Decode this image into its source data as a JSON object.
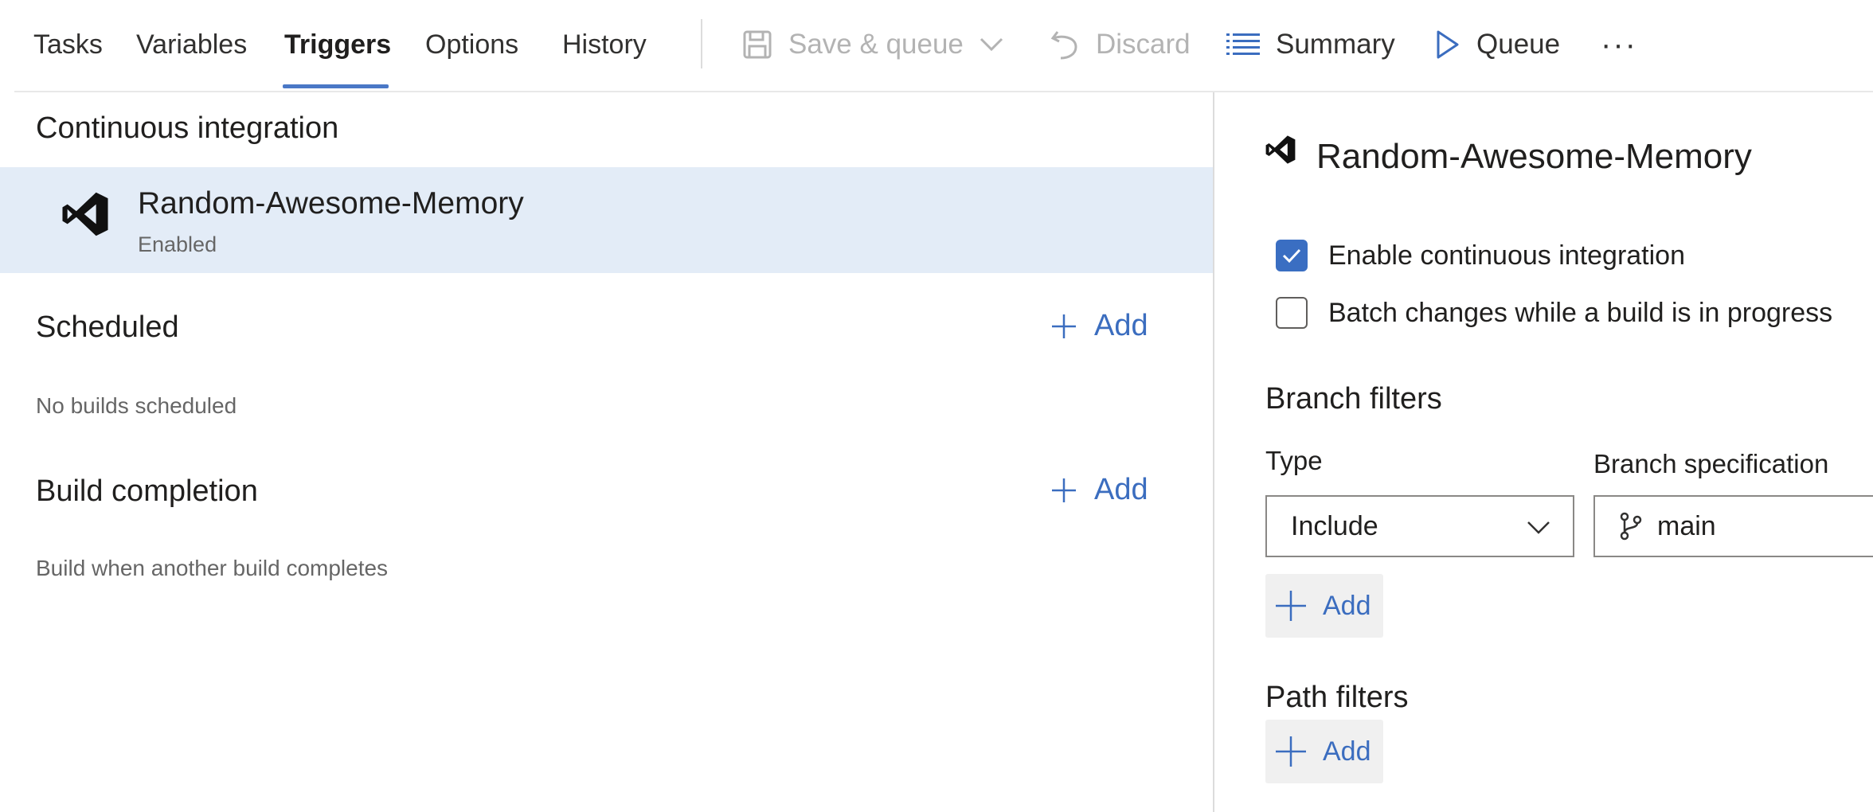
{
  "tabs": [
    {
      "label": "Tasks"
    },
    {
      "label": "Variables"
    },
    {
      "label": "Triggers",
      "active": true
    },
    {
      "label": "Options"
    },
    {
      "label": "History"
    }
  ],
  "toolbar": {
    "save_queue": "Save & queue",
    "discard": "Discard",
    "summary": "Summary",
    "queue": "Queue",
    "more": "···"
  },
  "left": {
    "ci": {
      "title": "Continuous integration",
      "repo_name": "Random-Awesome-Memory",
      "status": "Enabled"
    },
    "scheduled": {
      "title": "Scheduled",
      "add": "Add",
      "empty": "No builds scheduled"
    },
    "build_completion": {
      "title": "Build completion",
      "add": "Add",
      "description": "Build when another build completes"
    }
  },
  "right": {
    "title": "Random-Awesome-Memory",
    "enable_ci": {
      "label": "Enable continuous integration",
      "checked": true
    },
    "batch_changes": {
      "label": "Batch changes while a build is in progress",
      "checked": false
    },
    "branch_filters": {
      "title": "Branch filters",
      "type_label": "Type",
      "spec_label": "Branch specification",
      "type_value": "Include",
      "spec_value": "main",
      "add": "Add"
    },
    "path_filters": {
      "title": "Path filters",
      "add": "Add"
    }
  },
  "colors": {
    "accent": "#3b6dbf",
    "selected_row": "#e3ecf7",
    "checkbox_checked": "#3a6ec2",
    "tab_underline": "#4a78c6"
  },
  "icons": {
    "logo": "visual-studio-icon",
    "save": "save-icon",
    "discard": "undo-icon",
    "summary": "list-icon",
    "queue": "play-icon",
    "branch": "git-branch-icon",
    "add": "plus-icon"
  }
}
